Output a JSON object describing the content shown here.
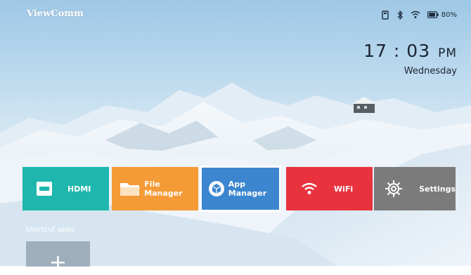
{
  "brand": "ViewComm",
  "status": {
    "battery_percent": "80%",
    "icons": [
      "usb-icon",
      "bluetooth-icon",
      "wifi-status-icon",
      "battery-icon"
    ]
  },
  "clock": {
    "time": "17 : 03",
    "ampm": "PM",
    "day": "Wednesday"
  },
  "tiles": [
    {
      "label": "HDMI",
      "icon": "hdmi-icon",
      "color": "#1fb7ad"
    },
    {
      "label": "File Manager",
      "icon": "folder-icon",
      "color": "#f49a37"
    },
    {
      "label": "App Manager",
      "icon": "cube-icon",
      "color": "#3b86cf",
      "selected": true
    },
    {
      "label": "WiFi",
      "icon": "wifi-icon",
      "color": "#e8333f"
    },
    {
      "label": "Settings",
      "icon": "gear-icon",
      "color": "#7b7b7b"
    }
  ],
  "shortcuts": {
    "label": "Shortcut apps",
    "add_symbol": "+"
  }
}
